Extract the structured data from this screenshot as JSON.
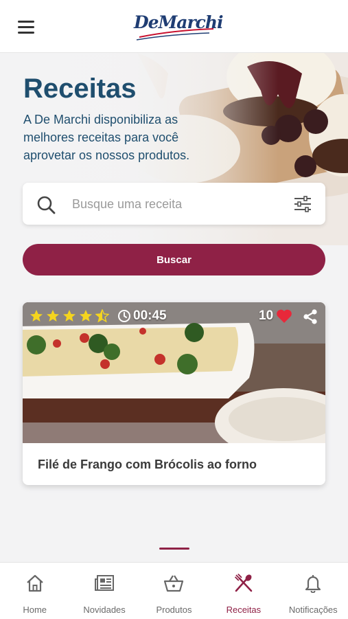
{
  "header": {
    "logo_text": "DeMarchi"
  },
  "hero": {
    "title": "Receitas",
    "subtitle": "A De Marchi disponibiliza as melhores receitas para você aprovetar os nossos produtos."
  },
  "search": {
    "placeholder": "Busque uma receita",
    "value": ""
  },
  "buttons": {
    "search_label": "Buscar"
  },
  "recipe_card": {
    "rating": 4.5,
    "rating_max": 5,
    "time": "00:45",
    "likes": "10",
    "title": "Filé de Frango com Brócolis ao forno"
  },
  "bottom_nav": {
    "items": [
      {
        "label": "Home",
        "icon": "home-icon"
      },
      {
        "label": "Novidades",
        "icon": "newspaper-icon"
      },
      {
        "label": "Produtos",
        "icon": "basket-icon"
      },
      {
        "label": "Receitas",
        "icon": "utensils-icon",
        "active": true
      },
      {
        "label": "Notificações",
        "icon": "bell-icon"
      }
    ]
  },
  "colors": {
    "brand": "#8f2146",
    "title_blue": "#1f4e6e",
    "logo_blue": "#1f3d73",
    "star": "#f5d51e",
    "heart": "#e8283a"
  }
}
